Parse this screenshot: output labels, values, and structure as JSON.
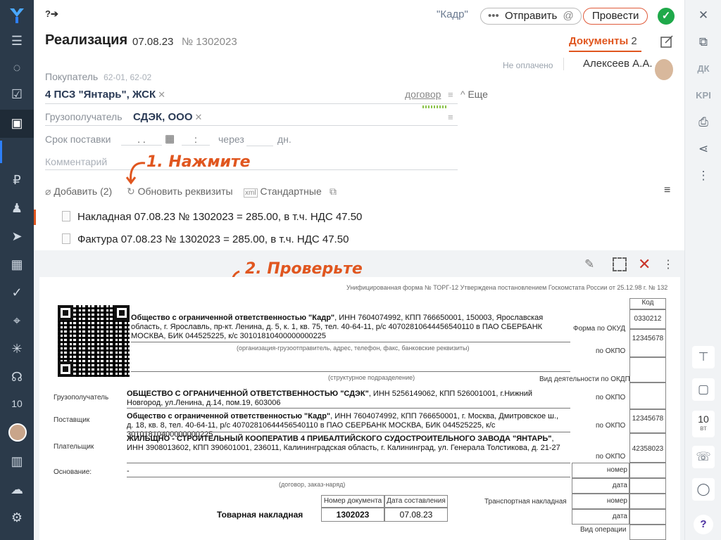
{
  "header": {
    "shortcut": "?➔",
    "org": "\"Кадр\"",
    "send_label": "Отправить",
    "at": "@",
    "post_label": "Провести",
    "ok": "✓",
    "title": "Реализация",
    "date": "07.08.23",
    "number_prefix": "№",
    "number": "1302023"
  },
  "docs_tab": {
    "label": "Документы",
    "count": "2"
  },
  "status": {
    "paid": "Не оплачено",
    "user": "Алексеев А.А."
  },
  "form": {
    "buyer_label": "Покупатель",
    "buyer_codes": "62-01, 62-02",
    "buyer_value": "4 ПСЗ \"Янтарь\", ЖСК",
    "contract_link": "договор",
    "more_label": "Еще",
    "consignee_label": "Грузополучатель",
    "consignee_value": "СДЭК, ООО",
    "delivery_label": "Срок поставки",
    "delivery_date": ". .",
    "delivery_time": ":",
    "through_label": "через",
    "days_label": "дн.",
    "comment_placeholder": "Комментарий"
  },
  "actions": {
    "add_label": "Добавить (2)",
    "update_label": "Обновить реквизиты",
    "standard_label": "Стандартные"
  },
  "annotations": {
    "click": "1. Нажмите",
    "check": "2. Проверьте"
  },
  "documents": [
    {
      "text": "Накладная 07.08.23 № 1302023 = 285.00, в т.ч. НДС 47.50"
    },
    {
      "text": "Фактура 07.08.23 № 1302023 = 285.00, в т.ч. НДС 47.50"
    }
  ],
  "preview": {
    "header_note": "Унифицированная форма № ТОРГ-12 Утверждена постановлением Госкомстата России от 25.12.98 г. № 132",
    "code_label": "Код",
    "okud_label": "Форма по ОКУД",
    "okud_value": "0330212",
    "okpo_label": "по ОКПО",
    "okpo1": "12345678",
    "sender_name": "Общество с ограниченной ответственностью \"Кадр\"",
    "sender_rest": ", ИНН 7604074992, КПП 766650001, 150003, Ярославская область, г. Ярославль, пр-кт. Ленина, д. 5, к. 1, кв. 75, тел. 40-64-11, р/с 40702810644456540110 в ПАО СБЕРБАНК МОСКВА, БИК 044525225, к/с 30101810400000000225",
    "sender_caption": "(организация-грузоотправитель, адрес, телефон, факс, банковские реквизиты)",
    "subdiv_caption": "(структурное подразделение)",
    "activity_label": "Вид деятельности по ОКДП",
    "consignee_label": "Грузополучатель",
    "consignee_name": "ОБЩЕСТВО С ОГРАНИЧЕННОЙ ОТВЕТСТВЕННОСТЬЮ \"СДЭК\"",
    "consignee_rest": ", ИНН 5256149062, КПП 526001001, г.Нижний Новгород, ул.Ленина, д.14, пом.19, 603006",
    "supplier_label": "Поставщик",
    "supplier_name": "Общество с ограниченной ответственностью \"Кадр\"",
    "supplier_rest": ", ИНН 7604074992, КПП 766650001, г. Москва, Дмитровское ш., д. 18, кв. 8, тел. 40-64-11, р/с 40702810644456540110 в ПАО СБЕРБАНК МОСКВА, БИК 044525225, к/с 30101810400000000225",
    "okpo2": "12345678",
    "payer_label": "Плательщик",
    "payer_name": "ЖИЛЬЩНО - СТРОИТЕЛЬНЫЙ КООПЕРАТИВ 4 ПРИБАЛТИЙСКОГО СУДОСТРОИТЕЛЬНОГО ЗАВОДА \"ЯНТАРЬ\"",
    "payer_rest": ", ИНН 3908013602, КПП 390601001, 236011, Калининградская область, г. Калининград, ул. Генерала Толстикова, д. 21-27",
    "okpo3": "42358023",
    "basis_label": "Основание:",
    "basis_value": "-",
    "basis_caption": "(договор, заказ-наряд)",
    "number_label": "номер",
    "date_label": "дата",
    "doc_num_header": "Номер документа",
    "doc_date_header": "Дата составления",
    "waybill_title": "Товарная накладная",
    "waybill_number": "1302023",
    "waybill_date": "07.08.23",
    "transport_label": "Транспортная накладная",
    "operation_label": "Вид операции"
  },
  "sidebar_left": {
    "date": "10"
  },
  "sidebar_right": {
    "dk": "ДК",
    "kpi": "KPI",
    "day": "10",
    "weekday": "вт",
    "help": "?"
  },
  "colors": {
    "accent": "#e0561f",
    "sidebar": "#2b3a4a",
    "ok": "#1fa94a"
  }
}
